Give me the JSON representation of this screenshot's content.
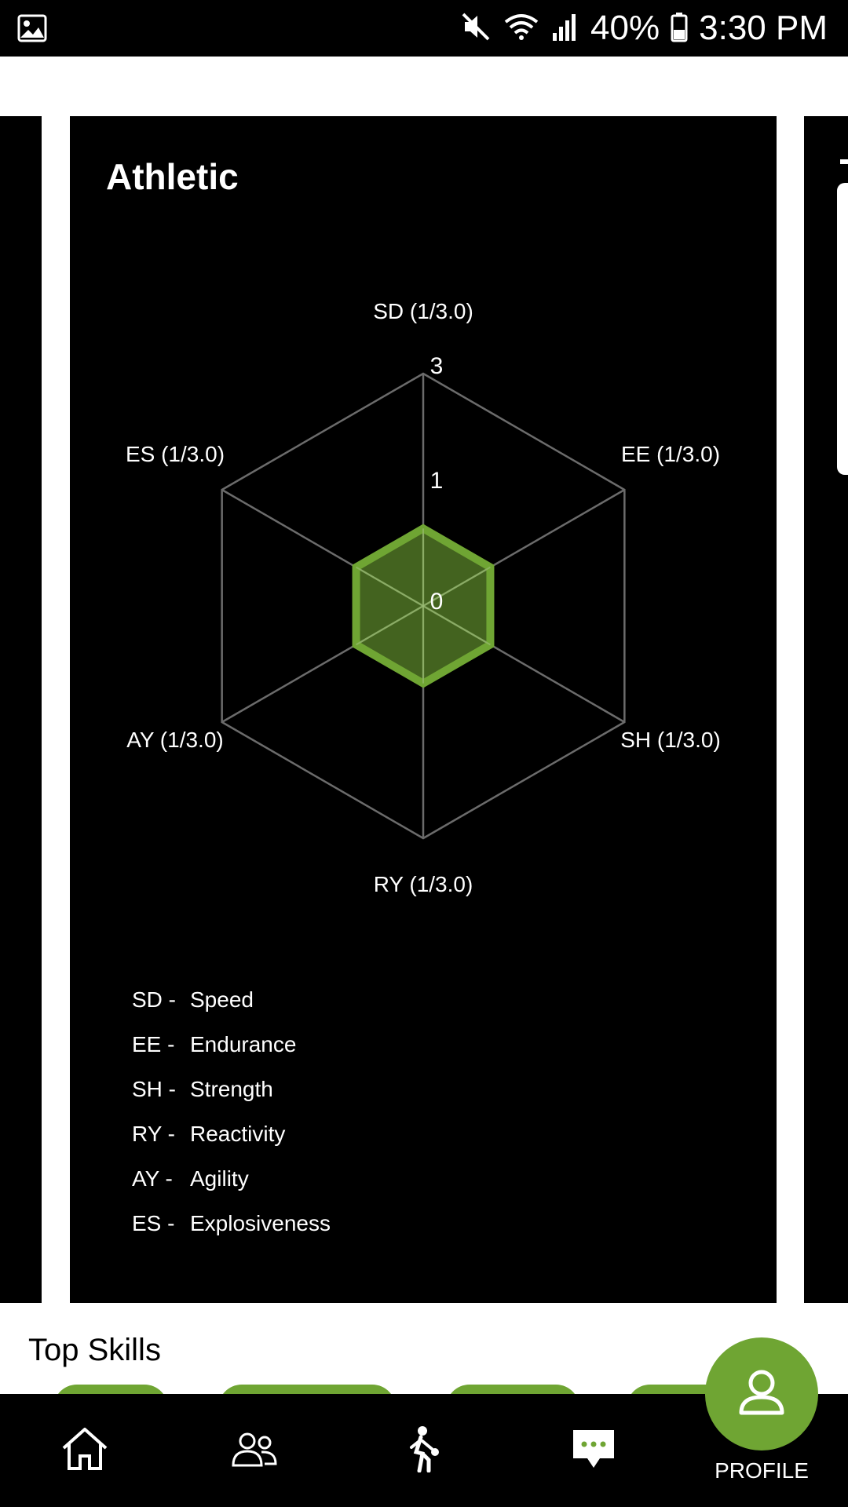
{
  "status_bar": {
    "battery": "40%",
    "time": "3:30 PM",
    "icons": [
      "image-icon",
      "mute-icon",
      "wifi-icon",
      "signal-icon",
      "battery-icon"
    ]
  },
  "card": {
    "title": "Athletic",
    "chart_data": {
      "type": "radar",
      "axes": [
        "SD (1/3.0)",
        "EE (1/3.0)",
        "SH (1/3.0)",
        "RY (1/3.0)",
        "AY (1/3.0)",
        "ES (1/3.0)"
      ],
      "values": [
        1,
        1,
        1,
        1,
        1,
        1
      ],
      "max": 3,
      "ticks": [
        "0",
        "1",
        "3"
      ],
      "series_color": "#6fa533"
    },
    "legend": [
      {
        "abbr": "SD -",
        "name": "Speed"
      },
      {
        "abbr": "EE -",
        "name": "Endurance"
      },
      {
        "abbr": "SH -",
        "name": "Strength"
      },
      {
        "abbr": "RY -",
        "name": "Reactivity"
      },
      {
        "abbr": "AY -",
        "name": "Agility"
      },
      {
        "abbr": "ES -",
        "name": "Explosiveness"
      }
    ]
  },
  "top_skills": {
    "title": "Top Skills"
  },
  "nav": {
    "items": [
      "home-icon",
      "team-icon",
      "player-icon",
      "chat-icon"
    ],
    "profile_label": "PROFILE"
  },
  "colors": {
    "accent": "#6fa533",
    "background": "#000000"
  }
}
